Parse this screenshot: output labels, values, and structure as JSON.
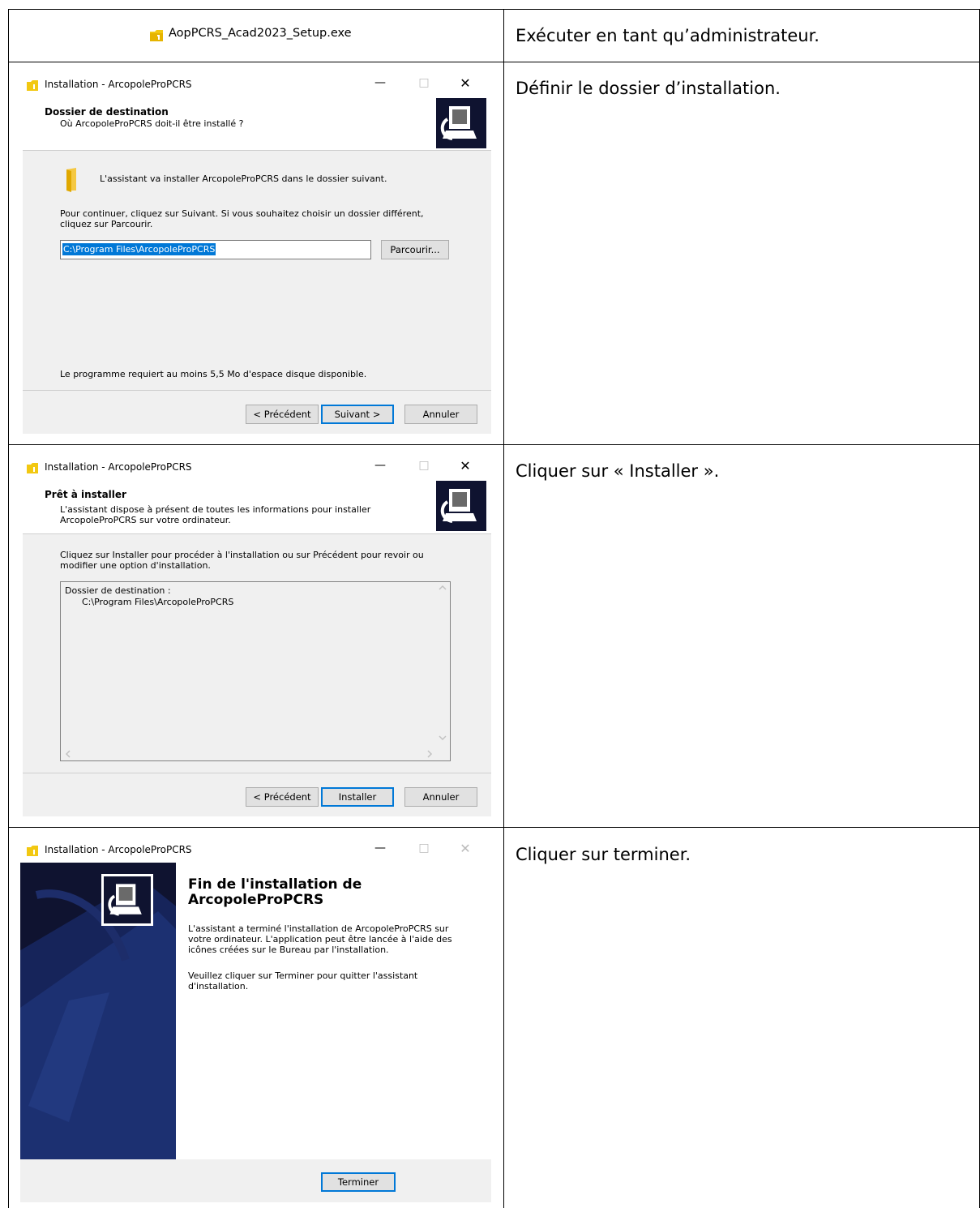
{
  "row1": {
    "exe_name": "AopPCRS_Acad2023_Setup.exe",
    "instruction": "Exécuter en tant qu’administrateur."
  },
  "row2": {
    "instruction": "Définir le dossier d’installation.",
    "window_title": "Installation - ArcopoleProPCRS",
    "header_title": "Dossier de destination",
    "header_subtitle": "Où ArcopoleProPCRS doit-il être installé ?",
    "info_line": "L'assistant va installer ArcopoleProPCRS dans le dossier suivant.",
    "continue_line1": "Pour continuer, cliquez sur Suivant. Si vous souhaitez choisir un dossier différent,",
    "continue_line2": "cliquez sur Parcourir.",
    "path_value": "C:\\Program Files\\ArcopoleProPCRS",
    "browse_label": "Parcourir...",
    "space_line": "Le programme requiert au moins 5,5 Mo d'espace disque disponible.",
    "back_label": "< Précédent",
    "next_label": "Suivant >",
    "cancel_label": "Annuler"
  },
  "row3": {
    "instruction": "Cliquer sur « Installer ».",
    "window_title": "Installation - ArcopoleProPCRS",
    "header_title": "Prêt à installer",
    "header_sub1": "L'assistant dispose à présent de toutes les informations pour installer",
    "header_sub2": "ArcopoleProPCRS sur votre ordinateur.",
    "info_line1": "Cliquez sur Installer pour procéder à l'installation ou sur Précédent pour revoir ou",
    "info_line2": "modifier une option d'installation.",
    "memo_line1": "Dossier de destination :",
    "memo_line2": "C:\\Program Files\\ArcopoleProPCRS",
    "back_label": "< Précédent",
    "install_label": "Installer",
    "cancel_label": "Annuler"
  },
  "row4": {
    "instruction": "Cliquer sur terminer.",
    "window_title": "Installation - ArcopoleProPCRS",
    "finish_title1": "Fin de l'installation de",
    "finish_title2": "ArcopoleProPCRS",
    "para1_line1": "L'assistant a terminé l'installation de ArcopoleProPCRS sur",
    "para1_line2": "votre ordinateur. L'application peut être lancée à l'aide des",
    "para1_line3": "icônes créées sur le Bureau par l'installation.",
    "para2_line1": "Veuillez cliquer sur Terminer pour quitter l'assistant",
    "para2_line2": "d'installation.",
    "finish_label": "Terminer"
  },
  "window_controls": {
    "minimize": "—",
    "maximize": "□",
    "close": "✕"
  },
  "colors": {
    "accent": "#0078d7",
    "icon_yellow": "#f2c811",
    "wizard_navy": "#0f1330",
    "body_gray": "#f0f0f0"
  }
}
